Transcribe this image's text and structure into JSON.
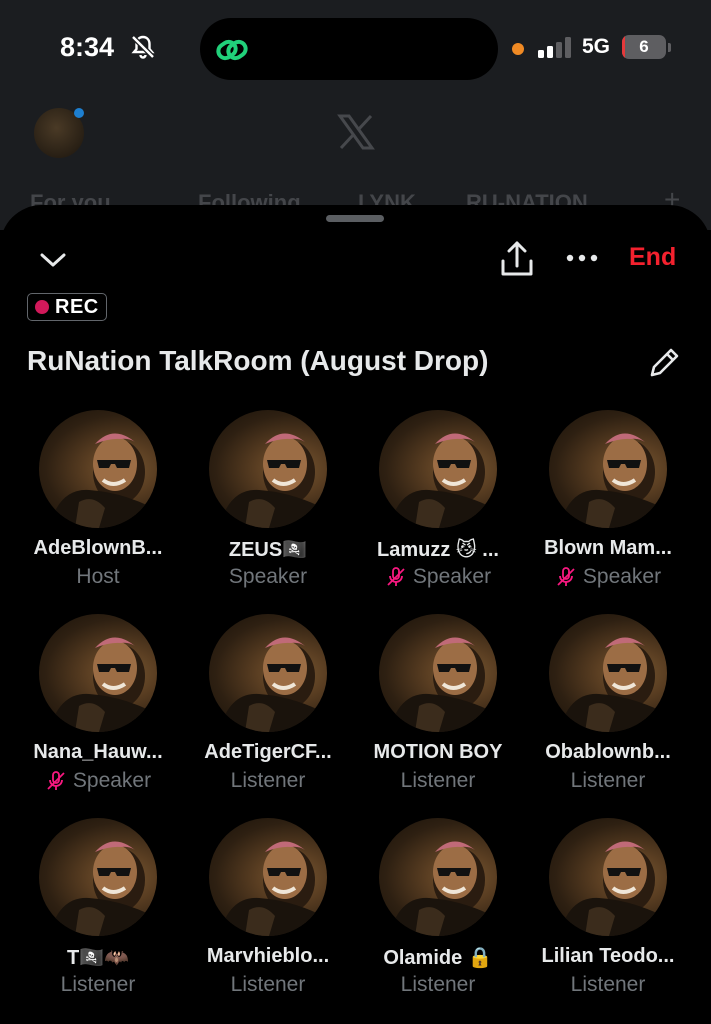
{
  "status_bar": {
    "time": "8:34",
    "network": "5G",
    "battery": "6",
    "battery_level": 0.06,
    "icons": [
      "bell-off-icon",
      "link-icon",
      "signal-icon",
      "battery-icon"
    ]
  },
  "background_app": {
    "logo": "x-logo-icon",
    "tabs": [
      "For you",
      "Following",
      "LYNK",
      "RU-NATION"
    ],
    "add_tab": "+"
  },
  "space": {
    "end_label": "End",
    "rec_label": "REC",
    "title": "RuNation TalkRoom (August Drop)",
    "colors": {
      "end": "#f4212e",
      "rec_dot": "#d1195a",
      "muted": "#f91880",
      "role": "#71767b"
    }
  },
  "participants": [
    {
      "name": "AdeBlownB...",
      "role": "Host",
      "muted": false
    },
    {
      "name": "ZEUS🏴‍☠️",
      "role": "Speaker",
      "muted": false
    },
    {
      "name": "Lamuzz 😼 ...",
      "role": "Speaker",
      "muted": true
    },
    {
      "name": "Blown Mam...",
      "role": "Speaker",
      "muted": true
    },
    {
      "name": "Nana_Hauw...",
      "role": "Speaker",
      "muted": true
    },
    {
      "name": "AdeTigerCF...",
      "role": "Listener",
      "muted": false
    },
    {
      "name": "MOTION BOY",
      "role": "Listener",
      "muted": false
    },
    {
      "name": "Obablownb...",
      "role": "Listener",
      "muted": false
    },
    {
      "name": "T🏴‍☠️🦇",
      "role": "Listener",
      "muted": false
    },
    {
      "name": "Marvhieblo...",
      "role": "Listener",
      "muted": false
    },
    {
      "name": "Olamide 🔒",
      "role": "Listener",
      "muted": false
    },
    {
      "name": "Lilian Teodo...",
      "role": "Listener",
      "muted": false
    }
  ]
}
